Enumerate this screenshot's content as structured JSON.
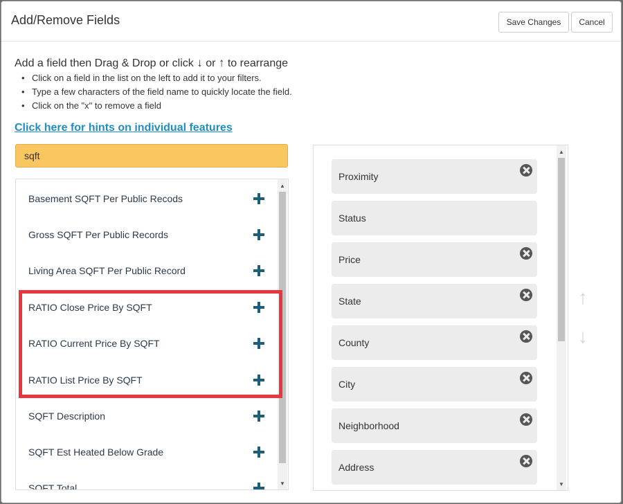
{
  "dialog": {
    "title": "Add/Remove Fields",
    "save_label": "Save Changes",
    "cancel_label": "Cancel"
  },
  "instructions": {
    "intro_prefix": "Add a field then Drag & Drop or click",
    "down_arrow": "↓",
    "or_text": "or",
    "up_arrow": "↑",
    "intro_suffix": "to rearrange",
    "bullets": [
      "Click on a field in the list on the left to add it to your filters.",
      "Type a few characters of the field name to quickly locate the field.",
      "Click on the \"x\" to remove a field"
    ],
    "hint_link": "Click here for hints on individual features"
  },
  "search": {
    "value": "sqft"
  },
  "available_fields": [
    "Basement SQFT Per Public Recods",
    "Gross SQFT Per Public Records",
    "Living Area SQFT Per Public Record",
    "RATIO Close Price By SQFT",
    "RATIO Current Price By SQFT",
    "RATIO List Price By SQFT",
    "SQFT Description",
    "SQFT Est Heated Below Grade",
    "SQFT Total"
  ],
  "selected_fields": [
    {
      "label": "Proximity",
      "removable": true
    },
    {
      "label": "Status",
      "removable": false
    },
    {
      "label": "Price",
      "removable": true
    },
    {
      "label": "State",
      "removable": true
    },
    {
      "label": "County",
      "removable": true
    },
    {
      "label": "City",
      "removable": true
    },
    {
      "label": "Neighborhood",
      "removable": true
    },
    {
      "label": "Address",
      "removable": true
    }
  ],
  "colors": {
    "search_bg": "#f9c65f",
    "link": "#1f8ec2",
    "plus_icon": "#1d5f7a",
    "highlight_box": "#e8363d",
    "chip_bg": "#ececec"
  }
}
